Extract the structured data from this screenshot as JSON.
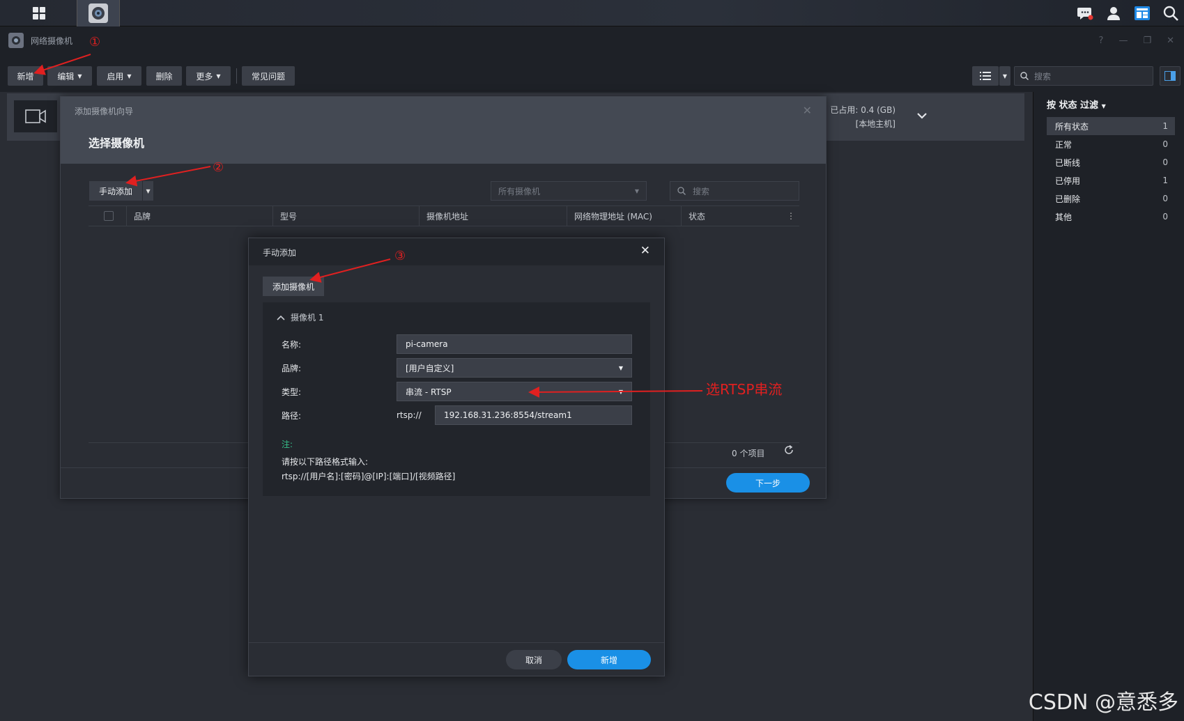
{
  "app": {
    "title": "网络摄像机"
  },
  "toolbar": {
    "new": "新增",
    "edit": "编辑",
    "enable": "启用",
    "delete": "删除",
    "more": "更多",
    "faq": "常见问题",
    "search_placeholder": "搜索"
  },
  "camera_row": {
    "usage_label": "已占用:",
    "usage_value": "0.4 (GB)",
    "host": "[本地主机]"
  },
  "sidebar": {
    "title": "按 状态 过滤",
    "items": [
      {
        "label": "所有状态",
        "count": "1",
        "active": true
      },
      {
        "label": "正常",
        "count": "0"
      },
      {
        "label": "已断线",
        "count": "0"
      },
      {
        "label": "已停用",
        "count": "1"
      },
      {
        "label": "已删除",
        "count": "0"
      },
      {
        "label": "其他",
        "count": "0"
      }
    ]
  },
  "wizard": {
    "subtitle": "添加摄像机向导",
    "title": "选择摄像机",
    "manual_add": "手动添加",
    "filter": "所有摄像机",
    "search_placeholder": "搜索",
    "columns": [
      "品牌",
      "型号",
      "摄像机地址",
      "网络物理地址 (MAC)",
      "状态"
    ],
    "items_count": "0 个项目",
    "next": "下一步"
  },
  "manual": {
    "title": "手动添加",
    "add_camera": "添加摄像机",
    "camera_header": "摄像机 1",
    "fields": {
      "name_label": "名称:",
      "name_value": "pi-camera",
      "brand_label": "品牌:",
      "brand_value": "[用户自定义]",
      "type_label": "类型:",
      "type_value": "串流 - RTSP",
      "path_label": "路径:",
      "path_prefix": "rtsp://",
      "path_value": "192.168.31.236:8554/stream1"
    },
    "note": "注:",
    "hint1": "请按以下路径格式输入:",
    "hint2": "rtsp://[用户名]:[密码]@[IP]:[端口]/[视频路径]",
    "cancel": "取消",
    "add": "新增"
  },
  "annotations": {
    "n1": "①",
    "n2": "②",
    "n3": "③",
    "rtsp_note": "选RTSP串流",
    "color": "#e02020"
  },
  "watermark": "CSDN @意悉多",
  "colors": {
    "accent": "#1a90e6",
    "note_green": "#37c08a"
  }
}
